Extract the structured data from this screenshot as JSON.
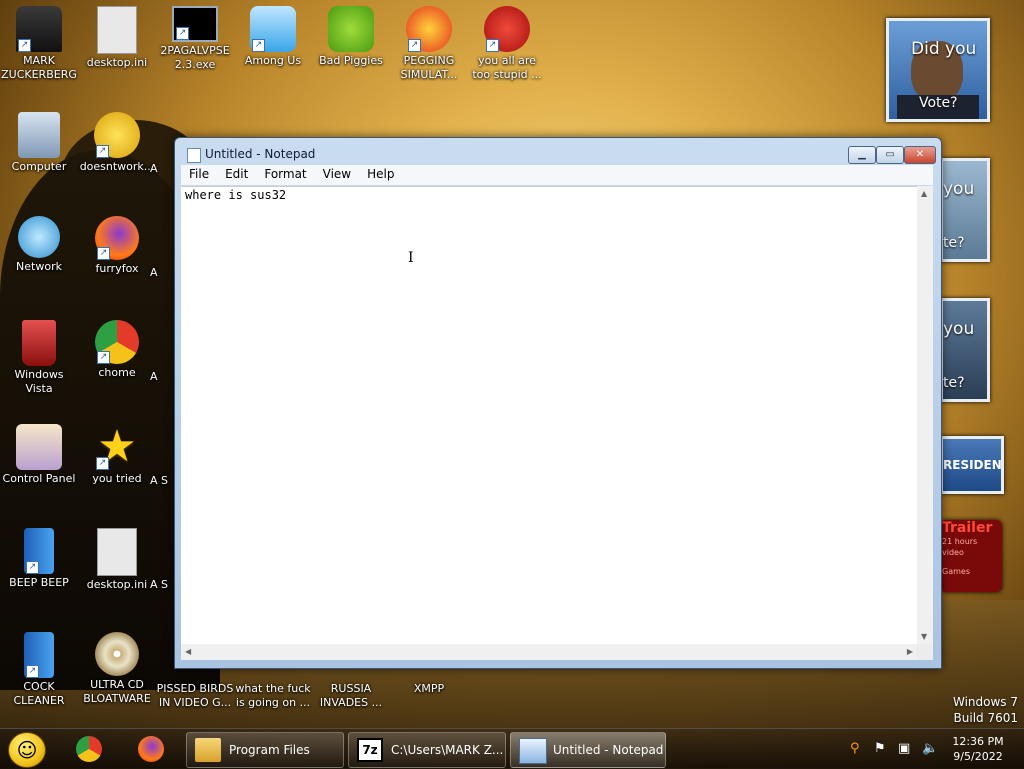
{
  "desktop": {
    "icons": [
      {
        "label": "MARK ZUCKERBERG",
        "icon": "person-icon"
      },
      {
        "label": "desktop.ini",
        "icon": "settings-file-icon"
      },
      {
        "label": "2PAGALVPSE 2.3.exe",
        "icon": "console-icon"
      },
      {
        "label": "Among Us",
        "icon": "among-us-icon"
      },
      {
        "label": "Bad Piggies",
        "icon": "pig-icon"
      },
      {
        "label": "PEGGING SIMULAT...",
        "icon": "p-logo-icon"
      },
      {
        "label": "you all are too stupid ...",
        "icon": "devcpp-icon"
      },
      {
        "label": "Computer",
        "icon": "computer-icon"
      },
      {
        "label": "doesntwork...",
        "icon": "yahoo-icon"
      },
      {
        "label": "Network",
        "icon": "network-icon"
      },
      {
        "label": "furryfox",
        "icon": "firefox-icon"
      },
      {
        "label": "Windows Vista",
        "icon": "recycle-bin-icon"
      },
      {
        "label": "chome",
        "icon": "chrome-icon"
      },
      {
        "label": "Control Panel",
        "icon": "control-panel-icon"
      },
      {
        "label": "you tried",
        "icon": "star-icon"
      },
      {
        "label": "BEEP BEEP",
        "icon": "blue-file-icon"
      },
      {
        "label": "desktop.ini",
        "icon": "settings-file-icon"
      },
      {
        "label": "COCK CLEANER",
        "icon": "blue-file-icon"
      },
      {
        "label": "ULTRA CD BLOATWARE",
        "icon": "cd-icon"
      },
      {
        "label": "PISSED BIRDS IN VIDEO G...",
        "icon": "bird-icon"
      },
      {
        "label": "what the fuck is going on ...",
        "icon": "question-icon"
      },
      {
        "label": "RUSSIA INVADES ...",
        "icon": "flag-icon"
      },
      {
        "label": "XMPP",
        "icon": "xmpp-icon"
      }
    ],
    "partial_labels": [
      "A",
      "A",
      "A",
      "A",
      "A",
      "A S",
      "A S"
    ],
    "gadgets": {
      "obama_text_top": "Did you",
      "obama_text_bottom": "Vote?",
      "g2_top": "you",
      "g2_bottom": "te?",
      "g3_top": "you",
      "g3_bottom": "te?",
      "president": "RESIDENT",
      "trailer": "Trailer",
      "trailer_sub1": "21 hours",
      "trailer_sub2": "video",
      "trailer_sub3": "Games"
    },
    "watermark_line1": "Windows 7",
    "watermark_line2": "Build 7601"
  },
  "notepad": {
    "title": "Untitled - Notepad",
    "menu": [
      "File",
      "Edit",
      "Format",
      "View",
      "Help"
    ],
    "content": "where is sus32",
    "btn_min": "▁",
    "btn_max": "▭",
    "btn_close": "✕"
  },
  "taskbar": {
    "tasks": [
      {
        "label": "Program Files",
        "icon": "folder-icon"
      },
      {
        "label": "C:\\Users\\MARK Z...",
        "icon": "7zip-icon"
      },
      {
        "label": "Untitled - Notepad",
        "icon": "notepad-icon"
      }
    ],
    "clock_time": "12:36 PM",
    "clock_date": "9/5/2022",
    "sevenzip_glyph": "7z"
  }
}
